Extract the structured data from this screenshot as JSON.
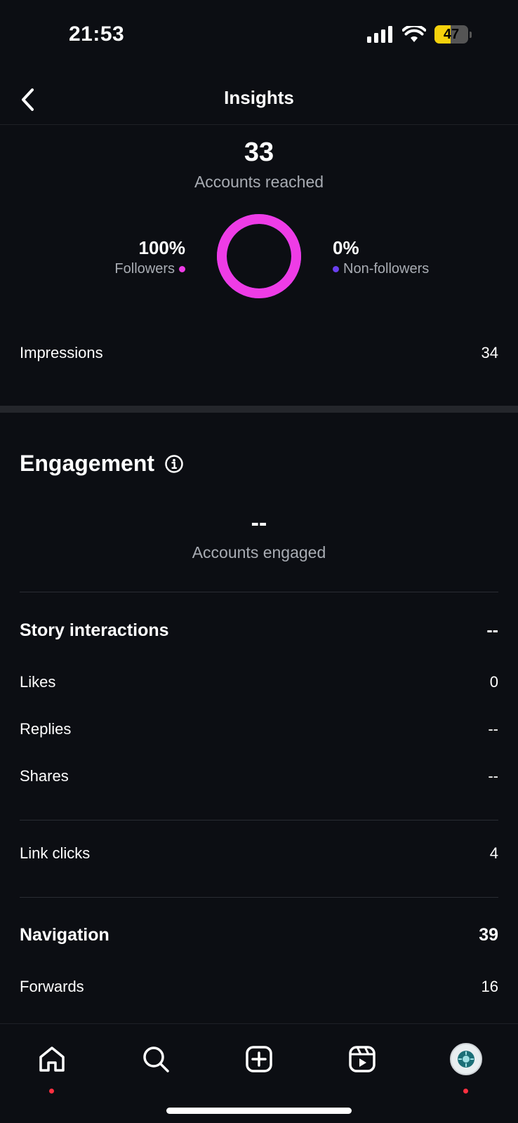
{
  "status_bar": {
    "time": "21:53",
    "battery": "47",
    "battery_level": 0.47
  },
  "header": {
    "title": "Insights"
  },
  "reach": {
    "count": "33",
    "label": "Accounts reached",
    "followers_pct": "100%",
    "followers_label": "Followers",
    "non_followers_pct": "0%",
    "non_followers_label": "Non-followers",
    "followers_fraction": 1.0,
    "followers_color": "#ee3ce6",
    "non_followers_color": "#6a3ff0"
  },
  "impressions": {
    "label": "Impressions",
    "value": "34"
  },
  "engagement": {
    "title": "Engagement",
    "accounts_engaged_value": "--",
    "accounts_engaged_label": "Accounts engaged"
  },
  "story_interactions": {
    "title": "Story interactions",
    "total": "--",
    "rows": [
      {
        "label": "Likes",
        "value": "0"
      },
      {
        "label": "Replies",
        "value": "--"
      },
      {
        "label": "Shares",
        "value": "--"
      }
    ]
  },
  "link_clicks": {
    "label": "Link clicks",
    "value": "4"
  },
  "navigation": {
    "title": "Navigation",
    "total": "39",
    "rows": [
      {
        "label": "Forwards",
        "value": "16"
      }
    ]
  },
  "tab_bar": {
    "items": [
      {
        "name": "home-icon"
      },
      {
        "name": "search-icon"
      },
      {
        "name": "create-icon"
      },
      {
        "name": "reels-icon"
      },
      {
        "name": "profile-avatar"
      }
    ]
  }
}
